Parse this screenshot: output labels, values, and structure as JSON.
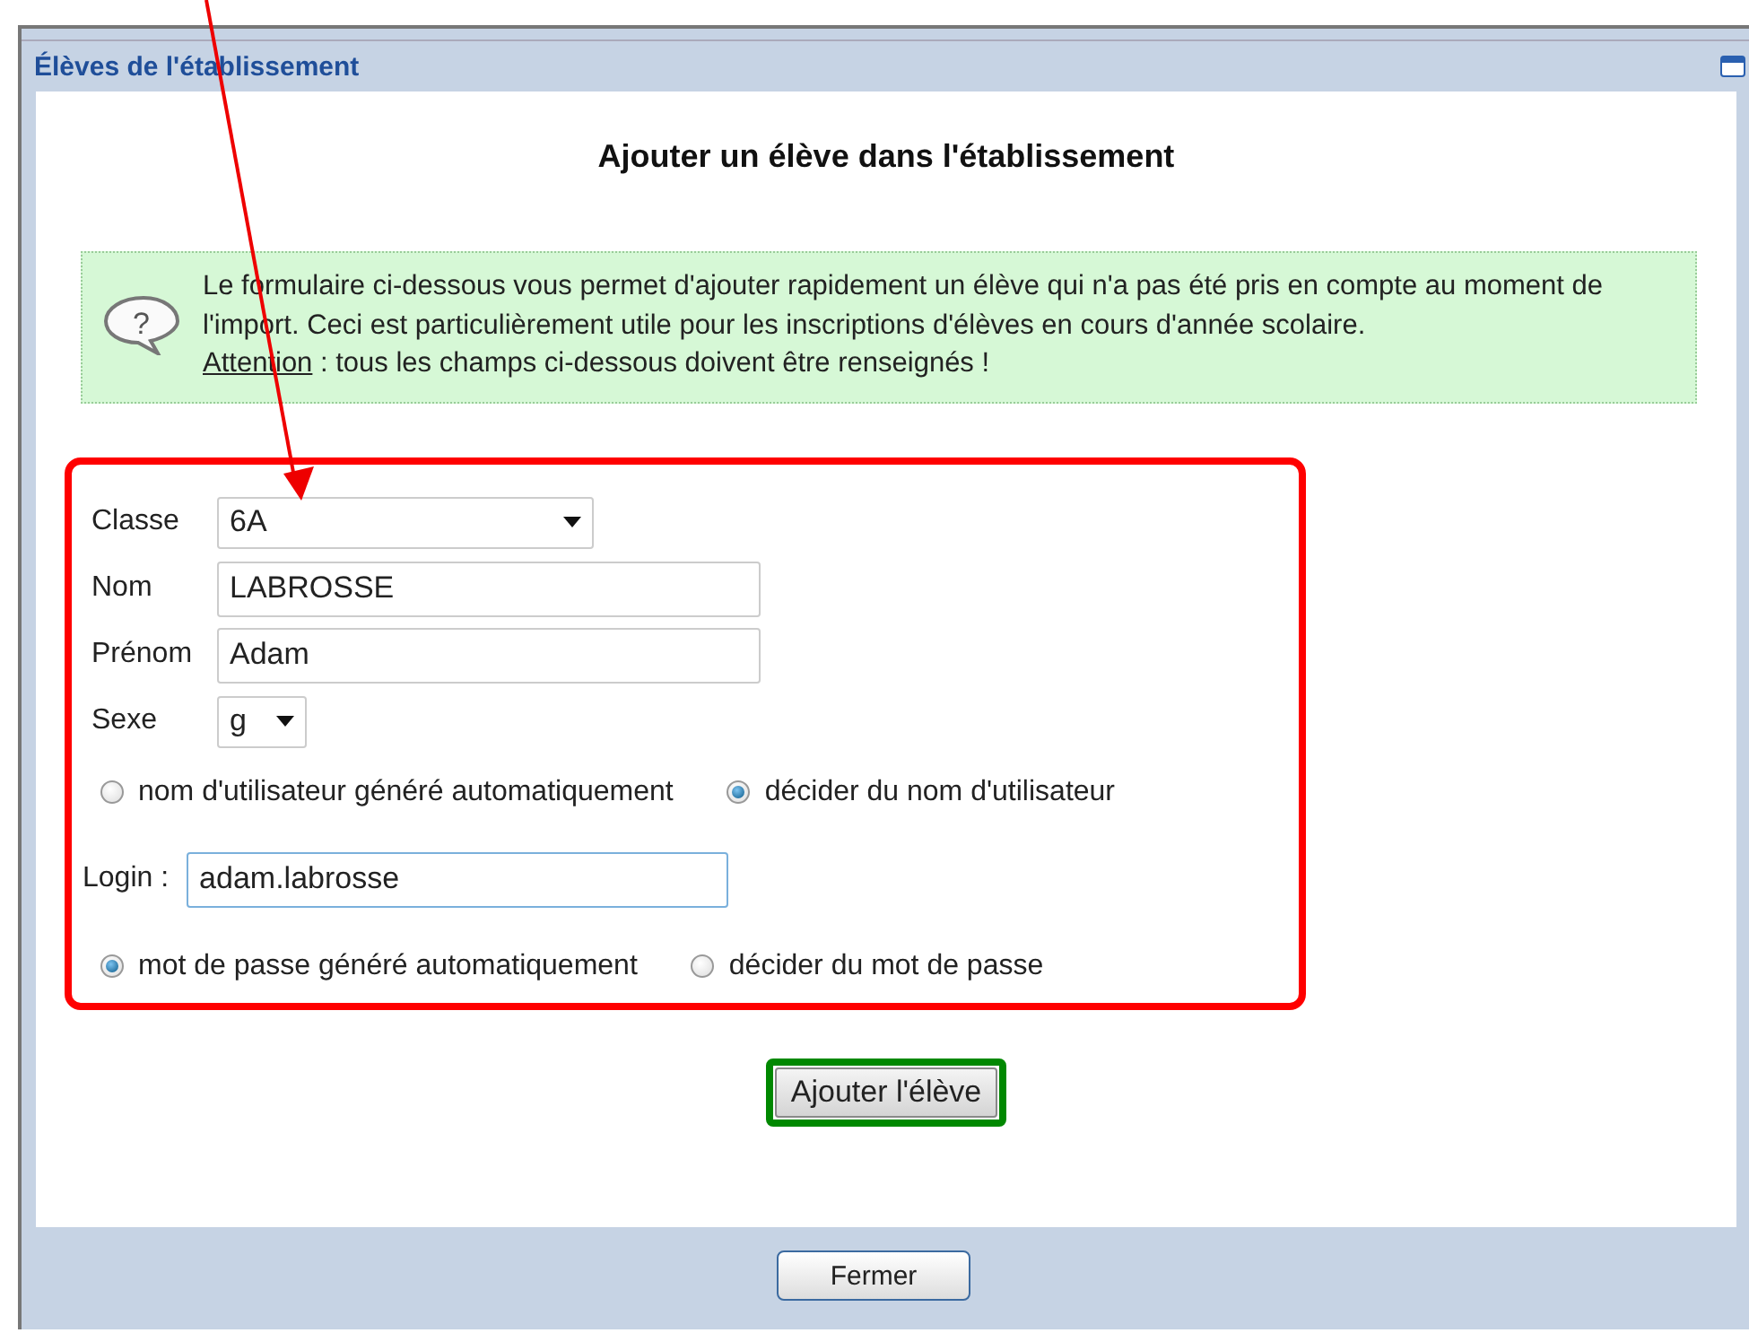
{
  "window": {
    "title": "Élèves de l'établissement",
    "heading": "Ajouter un élève dans l'établissement"
  },
  "info": {
    "icon": "?",
    "text": "Le formulaire ci-dessous vous permet d'ajouter rapidement un élève qui n'a pas été pris en compte au moment de l'import. Ceci est particulièrement utile pour les inscriptions d'élèves en cours d'année scolaire.",
    "warning_label": "Attention",
    "warning_text": " : tous les champs ci-dessous doivent être renseignés !"
  },
  "fields": [
    {
      "kind": "select",
      "label": "Classe",
      "value": "6A"
    },
    {
      "kind": "text",
      "label": "Nom",
      "value": "LABROSSE"
    },
    {
      "kind": "text",
      "label": "Prénom",
      "value": "Adam"
    },
    {
      "kind": "select",
      "label": "Sexe",
      "value": "g"
    }
  ],
  "username_options": [
    {
      "label": "nom d'utilisateur généré automatiquement",
      "selected": false
    },
    {
      "label": "décider du nom d'utilisateur",
      "selected": true
    }
  ],
  "login": {
    "label": "Login :",
    "value": "adam.labrosse",
    "focused": true
  },
  "password_options": [
    {
      "label": "mot de passe généré automatiquement",
      "selected": true
    },
    {
      "label": "décider du mot de passe",
      "selected": false
    }
  ],
  "submit_button": "Ajouter l'élève",
  "close_button": "Fermer"
}
